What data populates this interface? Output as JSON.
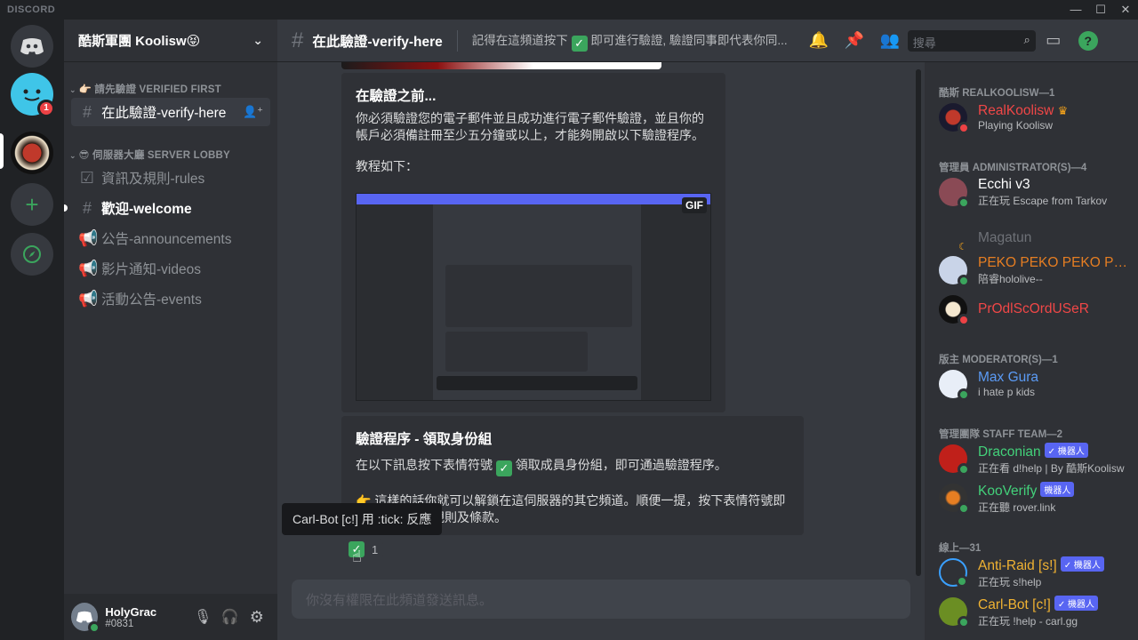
{
  "titlebar": {
    "brand": "DISCORD",
    "minimize": "—",
    "maximize": "☐",
    "close": "✕"
  },
  "guilds": {
    "badge_count": "1"
  },
  "server": {
    "name": "酷斯軍團 Koolisw😝"
  },
  "sidebar": {
    "cat1": "👉🏻 請先驗證 VERIFIED FIRST",
    "cat2": "😎 伺服器大廳 SERVER LOBBY",
    "channels": [
      {
        "label": "在此驗證-verify-here"
      },
      {
        "label": "資訊及規則-rules"
      },
      {
        "label": "歡迎-welcome"
      },
      {
        "label": "公告-announcements"
      },
      {
        "label": "影片通知-videos"
      },
      {
        "label": "活動公告-events"
      }
    ]
  },
  "user": {
    "name": "HolyGrac",
    "tag": "#0831"
  },
  "header": {
    "channel": "在此驗證-verify-here",
    "topic_pre": "記得在這頻道按下",
    "topic_post": "即可進行驗證, 驗證同事即代表你同...",
    "search_placeholder": "搜尋"
  },
  "embed1": {
    "title": "在驗證之前...",
    "body": "你必須驗證您的電子郵件並且成功進行電子郵件驗證，並且你的帳戶必須備註冊至少五分鐘或以上，才能夠開啟以下驗證程序。",
    "tutorial": "教程如下：",
    "gif_label": "GIF"
  },
  "embed2": {
    "title": "驗證程序 - 領取身份組",
    "line1_pre": "在以下訊息按下表情符號",
    "line1_post": "領取成員身份組，即可通過驗證程序。",
    "line2": "👉 這樣的話你就可以解鎖在這伺服器的其它頻道。順便一提，按下表情符號即",
    "line3": "代表您同意規則及條款。"
  },
  "reaction": {
    "count": "1"
  },
  "tooltip": {
    "text": "Carl-Bot [c!] 用 :tick: 反應"
  },
  "input": {
    "placeholder": "你沒有權限在此頻道發送訊息。"
  },
  "members": {
    "cat_owner": "酷斯 REALKOOLISW—1",
    "cat_admin": "管理員 ADMINISTRATOR(S)—4",
    "cat_mod": "版主 MODERATOR(S)—1",
    "cat_staff": "管理團隊 STAFF TEAM—2",
    "cat_online": "線上—31",
    "list": [
      {
        "name": "RealKoolisw",
        "activity": "Playing Koolisw",
        "color": "#f04747"
      },
      {
        "name": "Ecchi v3",
        "activity": "正在玩 Escape from Tarkov",
        "color": "#ffffff"
      },
      {
        "name": "Magatun",
        "activity": "",
        "color": "#6e7177"
      },
      {
        "name": "PEKO PEKO PEKO PEK...",
        "activity": "陪睿hololive--",
        "color": "#e67e22"
      },
      {
        "name": "PrOdlScOrdUSeR",
        "activity": "",
        "color": "#f04747"
      },
      {
        "name": "Max Gura",
        "activity": "i hate p kids",
        "color": "#5b9bf5"
      },
      {
        "name": "Draconian",
        "activity": "正在看 d!help | By 酷斯Koolisw",
        "color": "#43d17a",
        "tag": "✓ 機器人"
      },
      {
        "name": "KooVerify",
        "activity": "正在聽 rover.link",
        "color": "#43d17a",
        "tag": "機器人"
      },
      {
        "name": "Anti-Raid [s!]",
        "activity": "正在玩 s!help",
        "color": "#f0b232",
        "tag": "✓ 機器人"
      },
      {
        "name": "Carl-Bot [c!]",
        "activity": "正在玩 !help - carl.gg",
        "color": "#f0b232",
        "tag": "✓ 機器人"
      }
    ]
  }
}
